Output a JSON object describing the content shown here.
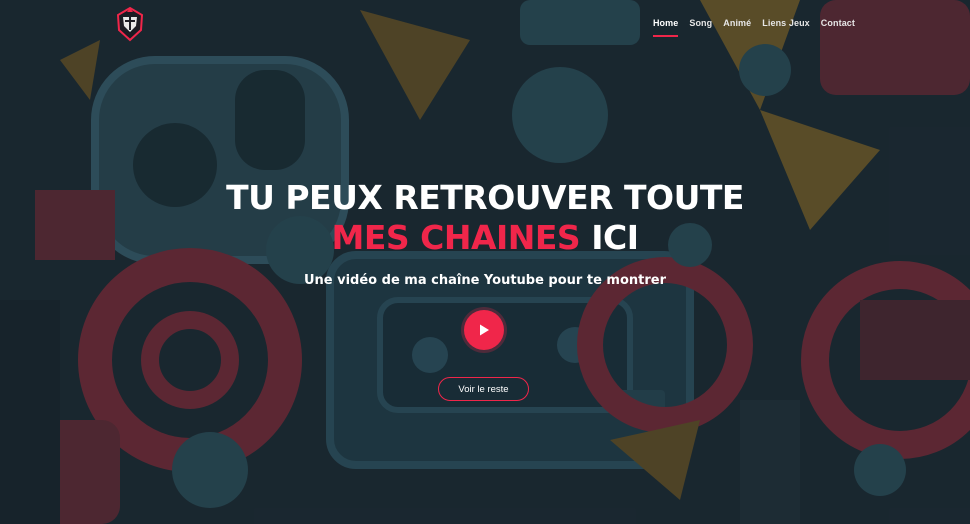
{
  "nav": {
    "items": [
      {
        "label": "Home",
        "active": true
      },
      {
        "label": "Song",
        "active": false
      },
      {
        "label": "Animé",
        "active": false
      },
      {
        "label": "Liens Jeux",
        "active": false
      },
      {
        "label": "Contact",
        "active": false
      }
    ]
  },
  "hero": {
    "title_line1": "TU PEUX RETROUVER TOUTE",
    "title_accent": "MES CHAINES",
    "title_end": "ICI",
    "subtitle": "Une vidéo de ma chaîne Youtube pour te montrer",
    "cta_label": "Voir le reste"
  },
  "icons": {
    "logo": "knight-helmet-logo",
    "play": "play-icon"
  },
  "colors": {
    "accent": "#f0264a",
    "background": "#1b2a33",
    "text": "#ffffff"
  }
}
